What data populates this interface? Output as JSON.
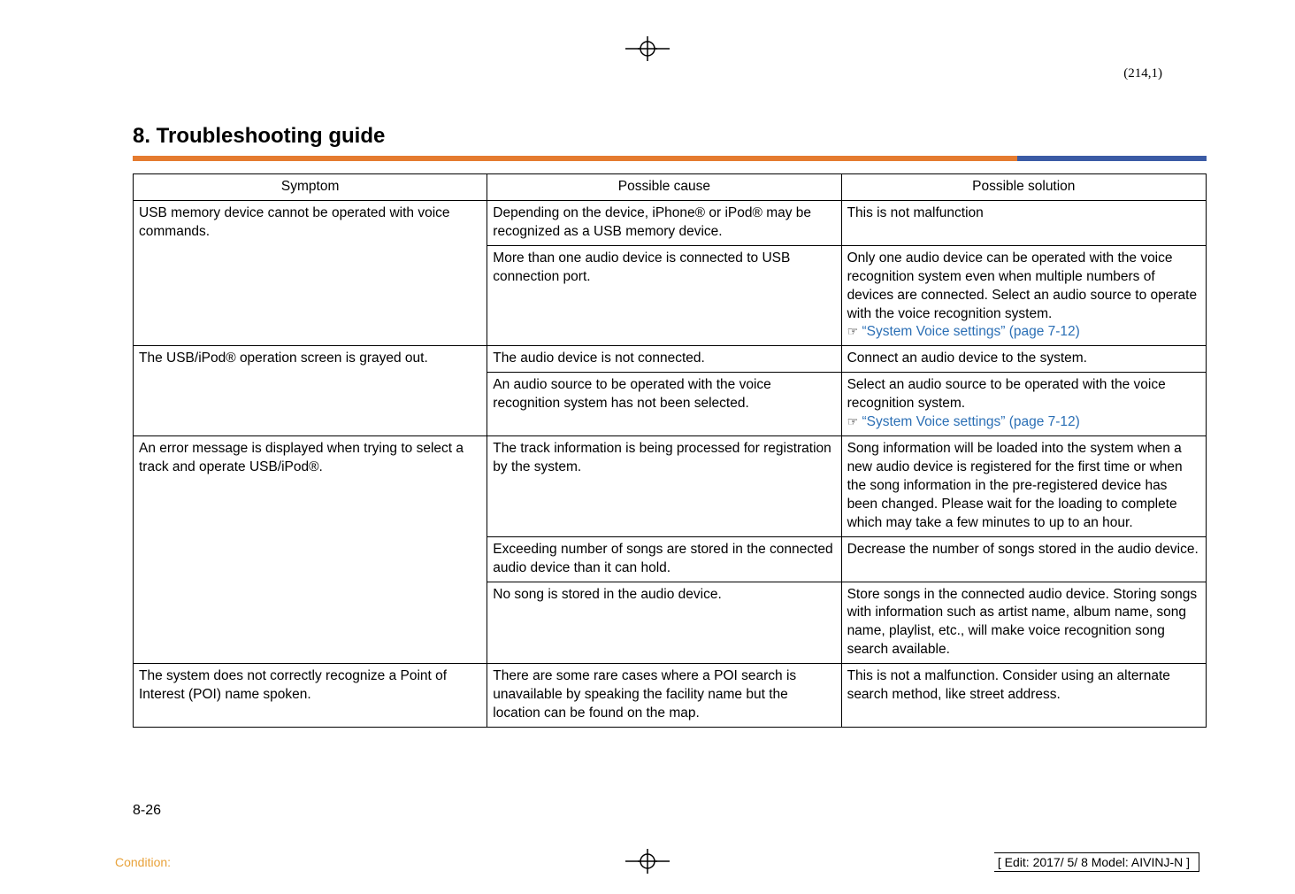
{
  "meta": {
    "page_ref_top": "(214,1)",
    "page_number": "8-26",
    "condition_label": "Condition:",
    "edit_info": "[ Edit: 2017/ 5/ 8   Model: AIVINJ-N ]"
  },
  "section_title": "8. Troubleshooting guide",
  "table": {
    "headers": [
      "Symptom",
      "Possible cause",
      "Possible solution"
    ],
    "rows": [
      {
        "symptom": "USB memory device cannot be operated with voice commands.",
        "symptom_rowspan": 2,
        "cause": "Depending on the device, iPhone® or iPod® may be recognized as a USB memory device.",
        "solution": "This is not malfunction"
      },
      {
        "cause": "More than one audio device is connected to USB connection port.",
        "solution": "Only one audio device can be operated with the voice recognition system even when multiple numbers of devices are connected. Select an audio source to operate with the voice recognition system.",
        "solution_link": "“System Voice settings” (page 7-12)"
      },
      {
        "symptom": "The USB/iPod® operation screen is grayed out.",
        "symptom_rowspan": 2,
        "cause": "The audio device is not connected.",
        "solution": "Connect an audio device to the system."
      },
      {
        "cause": "An audio source to be operated with the voice recognition system has not been selected.",
        "solution": "Select an audio source to be operated with the voice recognition system.",
        "solution_link": "“System Voice settings” (page 7-12)"
      },
      {
        "symptom": "An error message is displayed when trying to select a track and operate USB/iPod®.",
        "symptom_rowspan": 3,
        "cause": "The track information is being processed for registration by the system.",
        "solution": "Song information will be loaded into the system when a new audio device is registered for the first time or when the song information in the pre-registered device has been changed. Please wait for the loading to complete which may take a few minutes to up to an hour."
      },
      {
        "cause": "Exceeding number of songs are stored in the connected audio device than it can hold.",
        "solution": "Decrease the number of songs stored in the audio device."
      },
      {
        "cause": "No song is stored in the audio device.",
        "solution": "Store songs in the connected audio device. Storing songs with information such as artist name, album name, song name, playlist, etc., will make voice recognition song search available."
      },
      {
        "symptom": " The system does not correctly recognize a Point of Interest (POI) name spoken.",
        "symptom_rowspan": 1,
        "cause": "There are some rare cases where a POI search is unavailable by speaking the facility name but the location can be found on the map.",
        "solution": "This is not a malfunction. Consider using an alternate search method, like street address."
      }
    ]
  }
}
